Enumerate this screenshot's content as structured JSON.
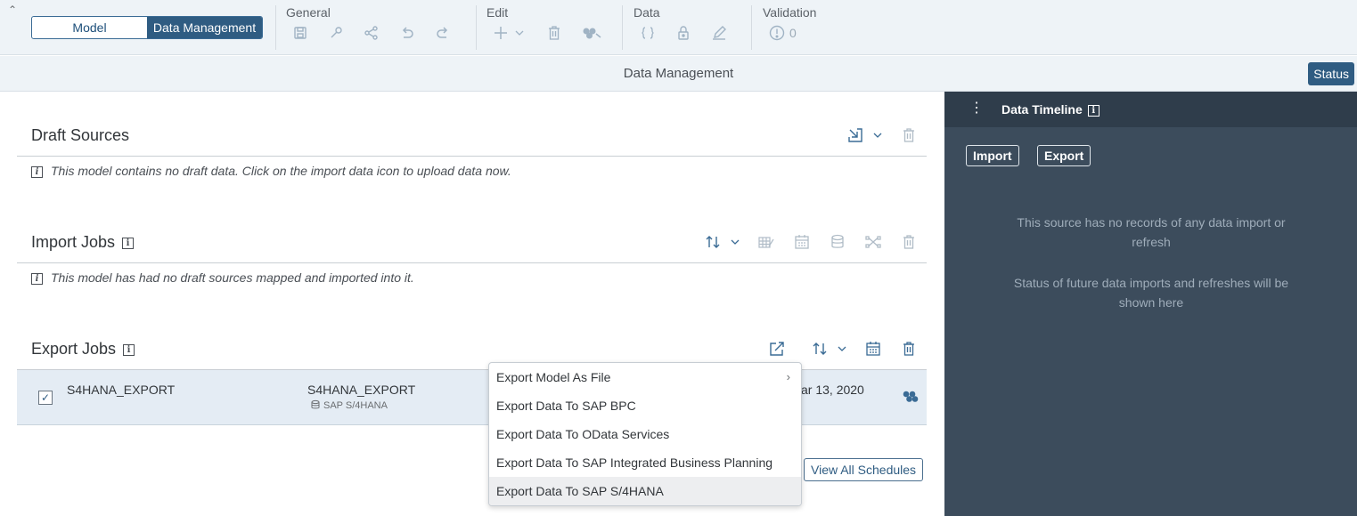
{
  "toolbar": {
    "segmented": {
      "model": "Model",
      "data_management": "Data Management"
    },
    "groups": {
      "general": "General",
      "edit": "Edit",
      "data": "Data",
      "validation": "Validation"
    },
    "validation_count": "0"
  },
  "titlebar": {
    "title": "Data Management",
    "status": "Status"
  },
  "draft_sources": {
    "title": "Draft Sources",
    "note": "This model contains no draft data. Click on the import data icon to upload data now."
  },
  "import_jobs": {
    "title": "Import Jobs",
    "note": "This model has had no draft sources mapped and imported into it."
  },
  "export_jobs": {
    "title": "Export Jobs",
    "rows": [
      {
        "name": "S4HANA_EXPORT",
        "target": "S4HANA_EXPORT",
        "target_type": "SAP S/4HANA",
        "date": "ar 13, 2020"
      }
    ],
    "view_all": "View All Schedules"
  },
  "export_menu": {
    "items": [
      {
        "label": "Export Model As File"
      },
      {
        "label": "Export Data To SAP BPC"
      },
      {
        "label": "Export Data To OData Services"
      },
      {
        "label": "Export Data To SAP Integrated Business Planning"
      },
      {
        "label": "Export Data To SAP S/4HANA"
      }
    ]
  },
  "timeline": {
    "title": "Data Timeline",
    "import": "Import",
    "export": "Export",
    "msg1": "This source has no records of any data import or refresh",
    "msg2": "Status of future data imports and refreshes will be shown here"
  },
  "colors": {
    "accent": "#2f5c82",
    "panel_dark": "#3c4c5c",
    "toolbar_bg": "#eef3f7"
  }
}
